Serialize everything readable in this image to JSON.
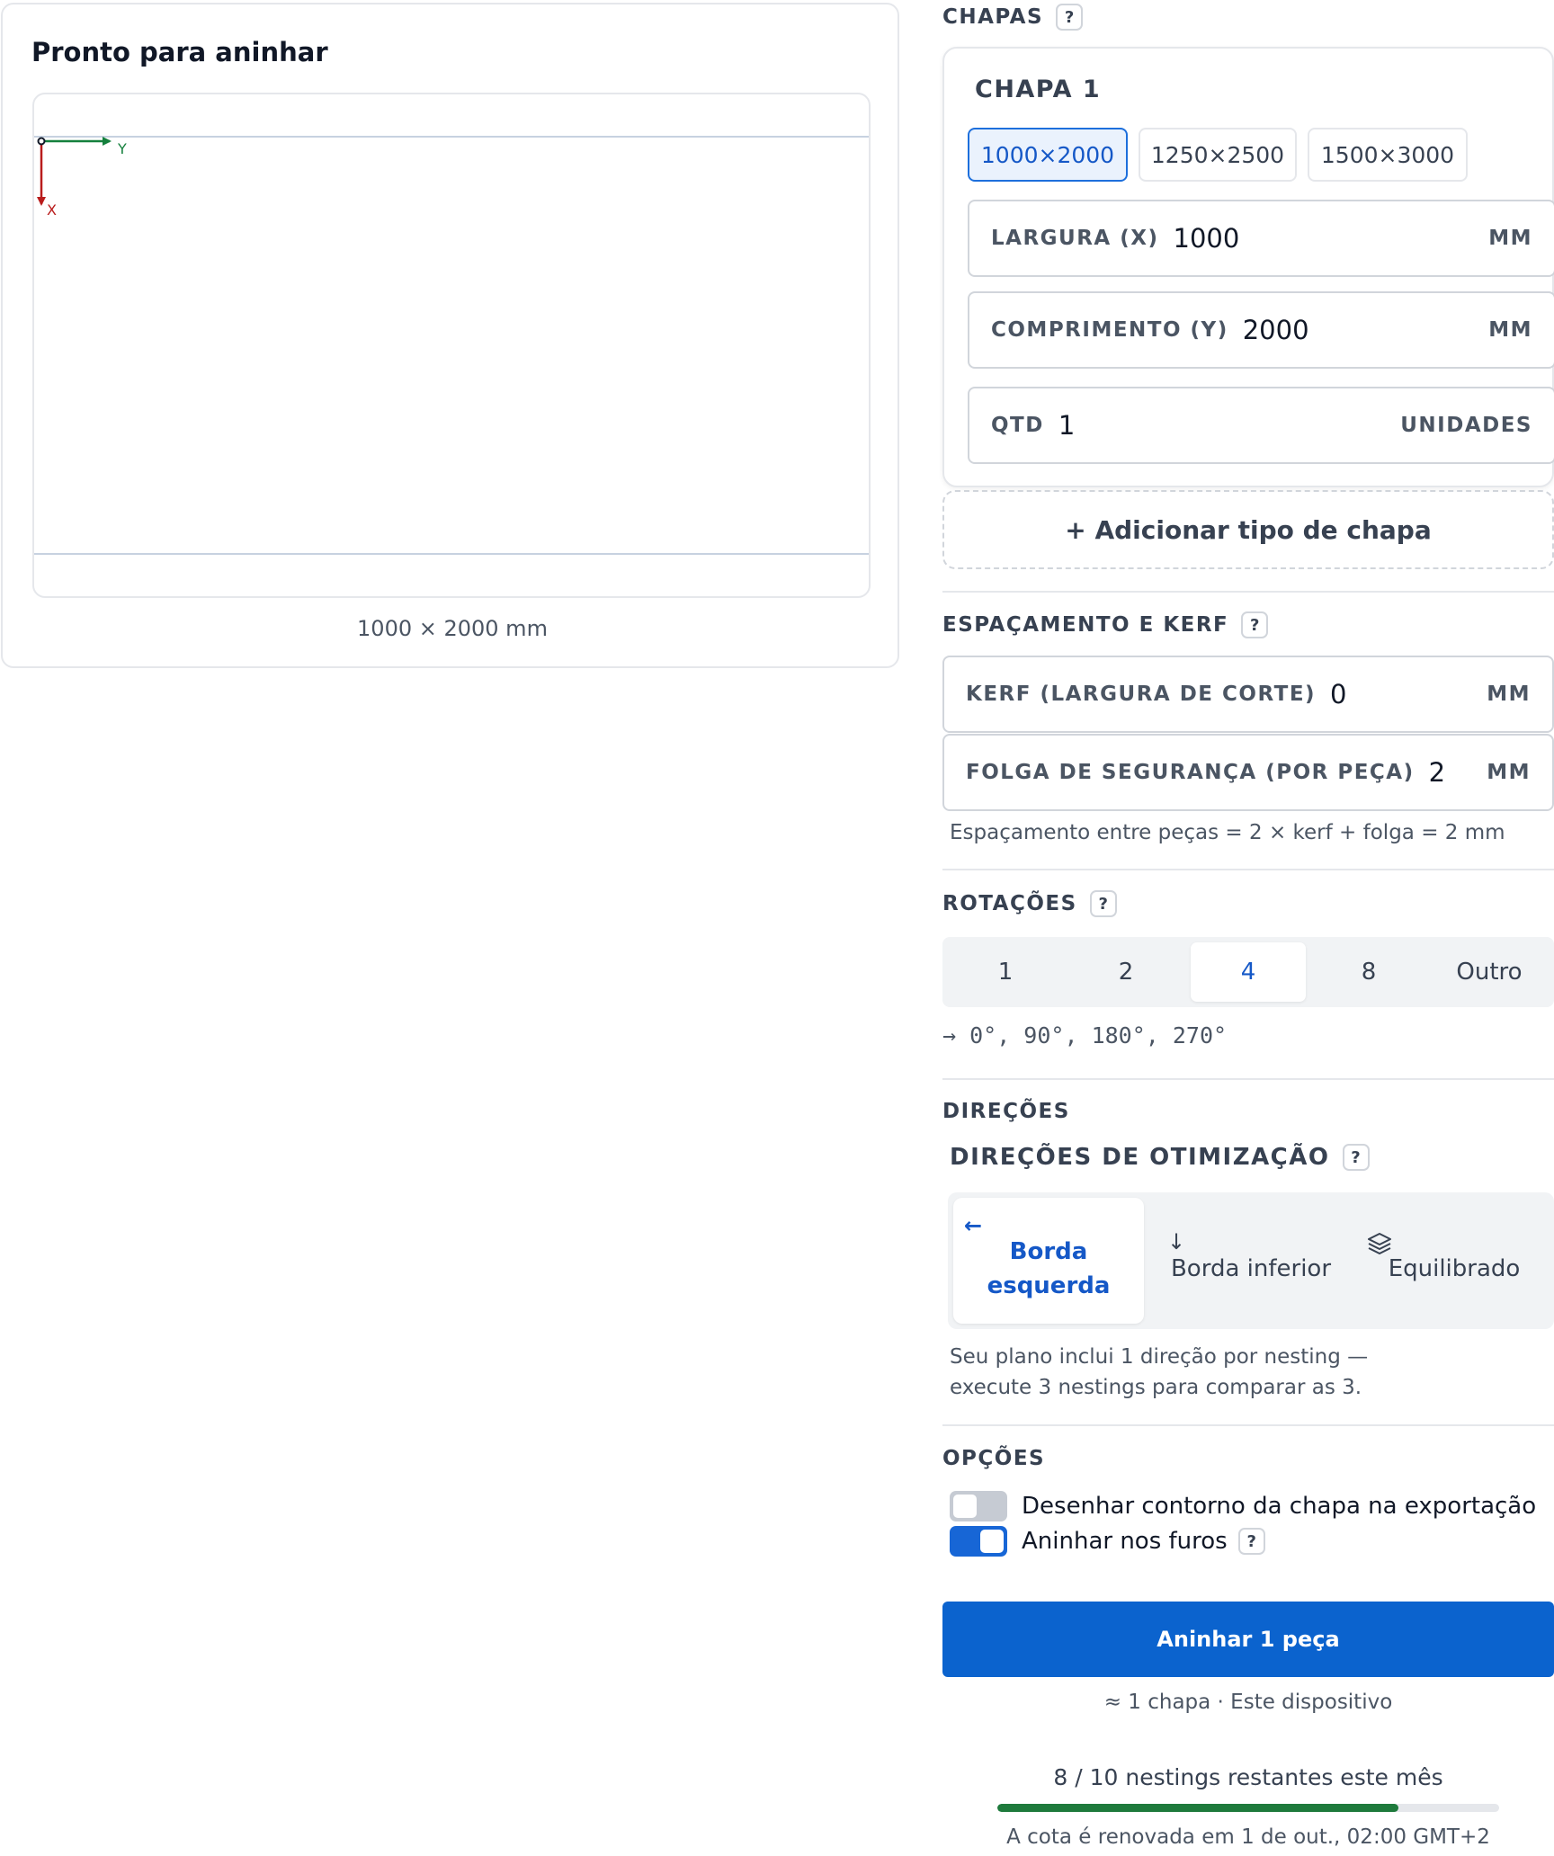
{
  "preview": {
    "title": "Pronto para aninhar",
    "axis_y": "Y",
    "axis_x": "X",
    "dimensions": "1000 × 2000 mm"
  },
  "sheets": {
    "title": "CHAPAS",
    "help": "?",
    "card_title": "CHAPA 1",
    "presets": [
      "1000×2000",
      "1250×2500",
      "1500×3000"
    ],
    "active_preset": "1000×2000",
    "width_label": "LARGURA (X)",
    "width_value": "1000",
    "width_unit": "MM",
    "length_label": "COMPRIMENTO (Y)",
    "length_value": "2000",
    "length_unit": "MM",
    "qty_label": "QTD",
    "qty_value": "1",
    "qty_unit": "UNIDADES",
    "add_label": "+ Adicionar tipo de chapa"
  },
  "spacing": {
    "title": "ESPAÇAMENTO E KERF",
    "help": "?",
    "kerf_label": "KERF (LARGURA DE CORTE)",
    "kerf_value": "0",
    "kerf_unit": "MM",
    "gap_label": "FOLGA DE SEGURANÇA (POR PEÇA)",
    "gap_value": "2",
    "gap_unit": "MM",
    "formula": "Espaçamento entre peças = 2 × kerf + folga = 2 mm"
  },
  "rotations": {
    "title": "ROTAÇÕES",
    "help": "?",
    "options": [
      "1",
      "2",
      "4",
      "8",
      "Outro"
    ],
    "active": "4",
    "result": "→ 0°, 90°, 180°, 270°"
  },
  "directions": {
    "title": "DIREÇÕES",
    "subtitle": "DIREÇÕES DE OTIMIZAÇÃO",
    "help": "?",
    "left_line1": "Borda",
    "left_line2": "esquerda",
    "bottom": "Borda inferior",
    "balanced": "Equilibrado",
    "note": "Seu plano inclui 1 direção por nesting — execute 3 nestings para comparar as 3."
  },
  "options": {
    "title": "OPÇÕES",
    "draw_outline": "Desenhar contorno da chapa na exportação",
    "draw_outline_on": false,
    "nest_holes": "Aninhar nos furos",
    "nest_holes_on": true,
    "help": "?"
  },
  "action": {
    "button": "Aninhar 1 peça",
    "sub": "≈ 1 chapa · Este dispositivo"
  },
  "quota": {
    "text": "8 / 10 nestings restantes este mês",
    "used_fraction": 0.8,
    "renew": "A cota é renovada em 1 de out., 02:00 GMT+2"
  },
  "colors": {
    "accent": "#0b63ce",
    "axis_x": "#b91c1c",
    "axis_y": "#15803d",
    "quota_fill": "#1e7a3c"
  }
}
